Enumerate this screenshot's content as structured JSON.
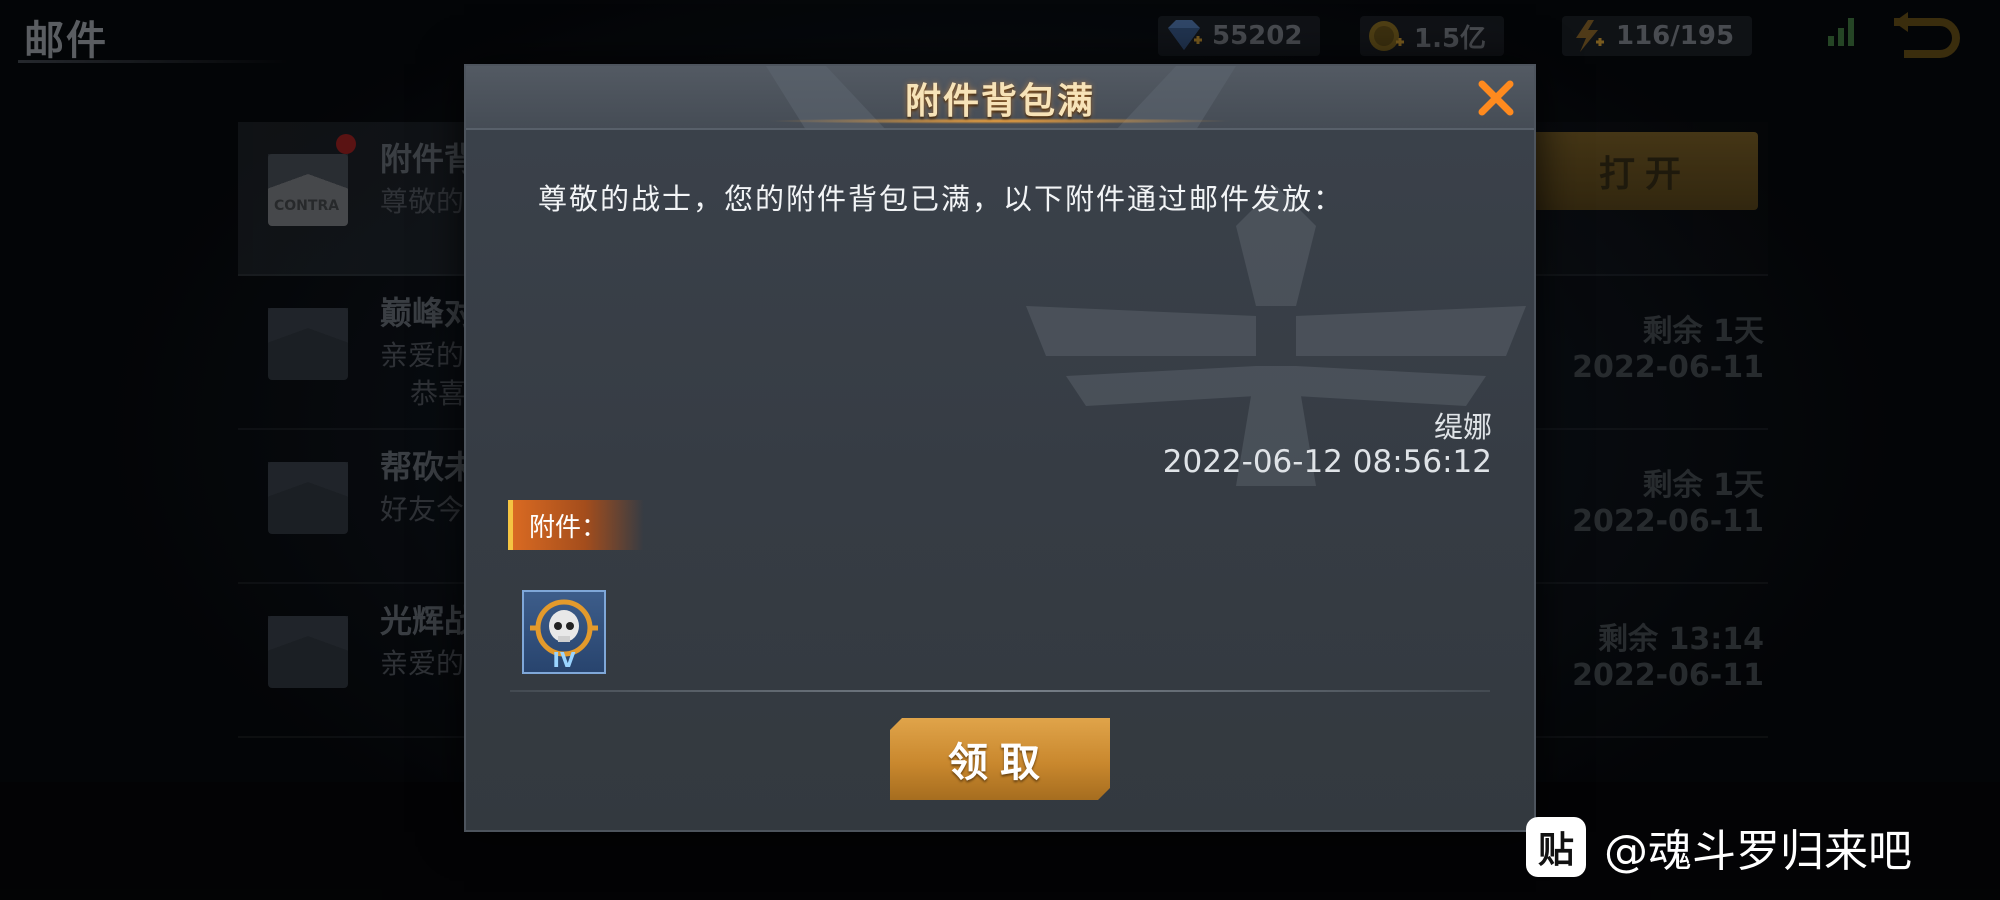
{
  "screen": {
    "title": "邮件"
  },
  "resources": {
    "diamonds": "55202",
    "gold": "1.5亿",
    "energy": "116/195"
  },
  "mail_list": [
    {
      "subject": "附件背",
      "line1": "尊敬的",
      "line2": "",
      "remain": "",
      "date": "",
      "has_open_button": true
    },
    {
      "subject": "巅峰对",
      "line1": "亲爱的",
      "line2": "恭喜",
      "remain": "剩余 1天",
      "date": "2022-06-11"
    },
    {
      "subject": "帮砍未",
      "line1": "好友今",
      "line2": "",
      "remain": "剩余 1天",
      "date": "2022-06-11"
    },
    {
      "subject": "光辉战",
      "line1": "亲爱的",
      "line2": "",
      "remain": "剩余 13:14",
      "date": "2022-06-11"
    }
  ],
  "mail_open_button": "打开",
  "mail_pkg_label": "CONTRA",
  "dialog": {
    "title": "附件背包满",
    "message": "尊敬的战士，您的附件背包已满，以下附件通过邮件发放：",
    "sender": "缇娜",
    "timestamp": "2022-06-12 08:56:12",
    "attachment_label": "附件：",
    "attachment_item_level": "IV",
    "claim_button": "领取"
  },
  "watermark": {
    "logo_text": "贴",
    "text": "@魂斗罗归来吧"
  },
  "colors": {
    "accent_gold": "#e0a44a",
    "title_text": "#f7e3b8",
    "close_orange": "#ff8a1e",
    "attach_tag": "#d96a22"
  }
}
